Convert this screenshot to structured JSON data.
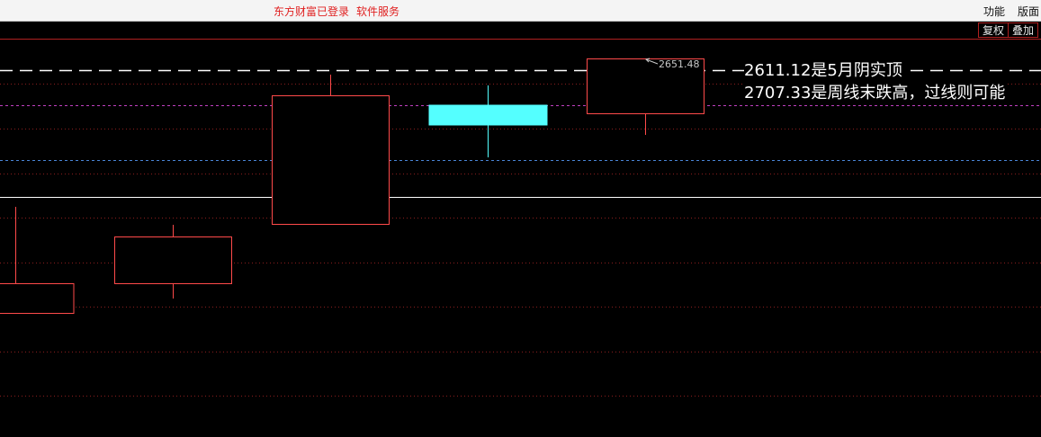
{
  "topbar": {
    "status_login": "东方财富已登录",
    "status_service": "软件服务",
    "menu": [
      "功能",
      "版面"
    ]
  },
  "toolbar": {
    "buttons": [
      "复权",
      "叠加"
    ]
  },
  "chart": {
    "type": "candlestick",
    "colors": {
      "up": "#ff4a4a",
      "down": "#54ffff",
      "grid": "#8a1e1e",
      "white_line": "#ffffff",
      "magenta_line": "#c040c0",
      "blue_line": "#4a86d8"
    },
    "high_marker": "2651.48",
    "annotations": {
      "line1": "2611.12是5月阴实顶",
      "line2": "2707.33是周线末跌高，过线则可能"
    }
  }
}
